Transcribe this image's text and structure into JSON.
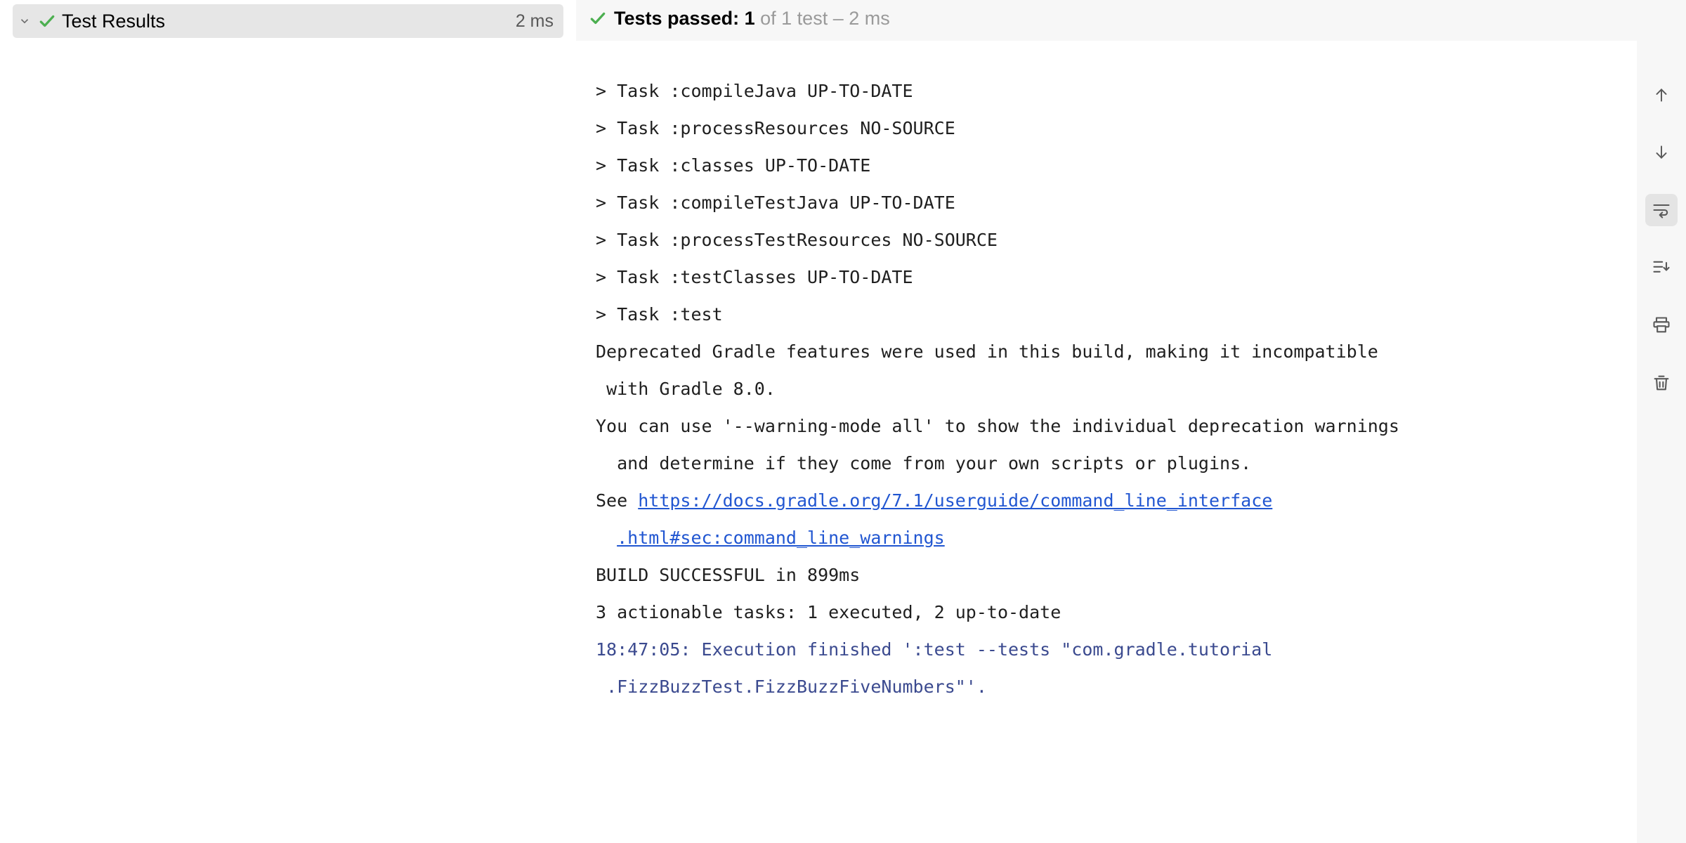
{
  "tree": {
    "root_label": "Test Results",
    "root_duration": "2 ms"
  },
  "header": {
    "prefix": "Tests passed:",
    "count": "1",
    "of": "of 1 test – 2 ms"
  },
  "console": {
    "lines": [
      "> Task :compileJava UP-TO-DATE",
      "> Task :processResources NO-SOURCE",
      "> Task :classes UP-TO-DATE",
      "> Task :compileTestJava UP-TO-DATE",
      "> Task :processTestResources NO-SOURCE",
      "> Task :testClasses UP-TO-DATE",
      "> Task :test",
      "Deprecated Gradle features were used in this build, making it incompatible",
      " with Gradle 8.0.",
      "You can use '--warning-mode all' to show the individual deprecation warnings",
      "  and determine if they come from your own scripts or plugins."
    ],
    "see_prefix": "See ",
    "link_text_1": "https://docs.gradle.org/7.1/userguide/command_line_interface",
    "link_text_2": ".html#sec:command_line_warnings",
    "build_line": "BUILD SUCCESSFUL in 899ms",
    "tasks_line": "3 actionable tasks: 1 executed, 2 up-to-date",
    "finished_line_1": "18:47:05: Execution finished ':test --tests \"com.gradle.tutorial",
    "finished_line_2": ".FizzBuzzTest.FizzBuzzFiveNumbers\"'."
  }
}
